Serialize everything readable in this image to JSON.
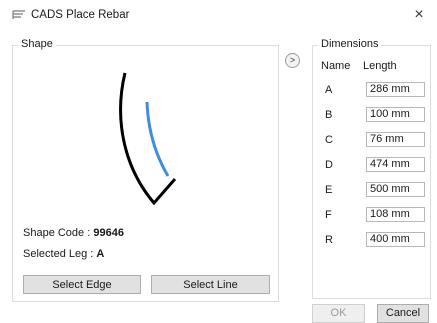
{
  "window": {
    "title": "CADS Place Rebar",
    "close_glyph": "×",
    "icon": "rebar-app-icon"
  },
  "shape_panel": {
    "legend": "Shape",
    "shape_code_label": "Shape Code : ",
    "shape_code_value": "99646",
    "selected_leg_label": "Selected Leg : ",
    "selected_leg_value": "A",
    "select_edge_label": "Select Edge",
    "select_line_label": "Select Line",
    "selected_leg_color": "#3d8fdc",
    "shape_color": "#000000"
  },
  "nav_button_glyph": ">",
  "dimensions_panel": {
    "legend": "Dimensions",
    "name_header": "Name",
    "length_header": "Length",
    "rows": [
      {
        "name": "A",
        "length": "286 mm"
      },
      {
        "name": "B",
        "length": "100 mm"
      },
      {
        "name": "C",
        "length": "76 mm"
      },
      {
        "name": "D",
        "length": "474 mm"
      },
      {
        "name": "E",
        "length": "500 mm"
      },
      {
        "name": "F",
        "length": "108 mm"
      },
      {
        "name": "R",
        "length": "400 mm"
      }
    ]
  },
  "footer": {
    "ok_label": "OK",
    "cancel_label": "Cancel"
  }
}
